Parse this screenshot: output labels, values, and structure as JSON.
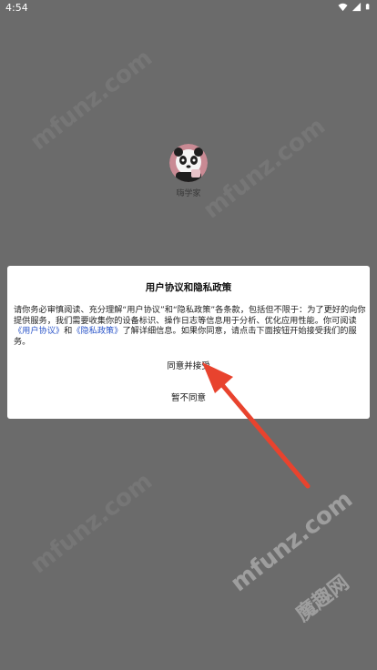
{
  "status_bar": {
    "time": "4:54"
  },
  "app": {
    "name": "嗨学家"
  },
  "dialog": {
    "title": "用户协议和隐私政策",
    "body": {
      "part1": "请你务必审慎阅读、充分理解“用户协议”和“隐私政策”各条款，包括但不限于：为了更好的向你提供服务，我们需要收集你的设备标识、操作日志等信息用于分析、优化应用性能。你可阅读",
      "link1": "《用户协议》",
      "and": "和",
      "link2": "《隐私政策》",
      "part2": "了解详细信息。如果你同意，请点击下面按钮开始接受我们的服务。"
    },
    "agree_label": "同意并接受",
    "disagree_label": "暂不同意"
  },
  "watermark": {
    "text": "mfunz.com",
    "brand": "魔趣网"
  },
  "colors": {
    "overlay": "#6b6b6b",
    "link": "#2b55c9",
    "arrow": "#e8432e"
  }
}
